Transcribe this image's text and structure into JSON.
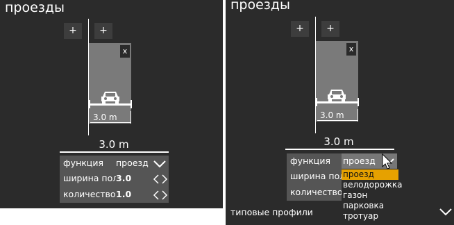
{
  "left": {
    "title": "проезды",
    "add_left": "+",
    "add_right": "+",
    "close": "x",
    "lane_width": "3.0 m",
    "total_width": "3.0 m",
    "props": {
      "function_label": "функция",
      "function_value": "проезд",
      "width_label": "ширина полосы",
      "width_value": "3.0",
      "count_label": "количество полос",
      "count_value": "1.0"
    }
  },
  "right": {
    "title": "проезды",
    "add_left": "+",
    "add_right": "+",
    "close": "x",
    "lane_width": "3.0 m",
    "total_width": "3.0 m",
    "props": {
      "function_label": "функция",
      "function_value": "проезд",
      "width_label": "ширина полосы",
      "count_label": "количество полос"
    },
    "dropdown": {
      "options": [
        "проезд",
        "велодорожка",
        "газон",
        "парковка",
        "тротуар"
      ],
      "selected": "проезд"
    },
    "footer": {
      "label": "типовые профили"
    }
  },
  "colors": {
    "background": "#2b2b2b",
    "lane": "#7a7a7a",
    "props_panel": "#555555",
    "accent": "#e6a100"
  },
  "icons": [
    "car-icon",
    "close-icon",
    "chevron-down-icon",
    "chevron-left-icon",
    "chevron-right-icon",
    "cursor-icon"
  ]
}
